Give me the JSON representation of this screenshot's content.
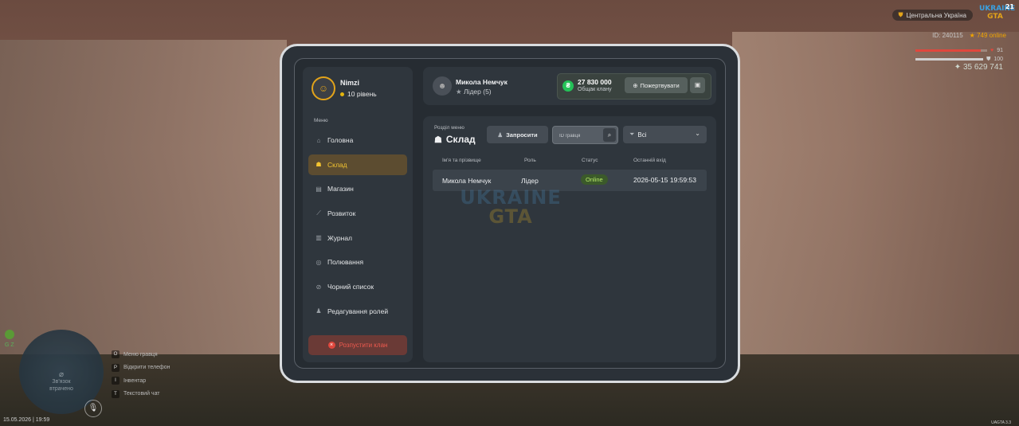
{
  "hud": {
    "server_name": "Центральна Україна",
    "logo_line1": "UKRAINE",
    "logo_line2": "GTA",
    "player_level": "21",
    "player_id": "ID: 240115",
    "online": "749 online",
    "health": "91",
    "armor": "100",
    "money": "35 629 741",
    "minimap_text_1": "Зв'язок",
    "minimap_text_2": "втрачено",
    "gps_label": "G Z",
    "mic_key": "B",
    "hints": [
      {
        "key": "O",
        "label": "Меню гравця"
      },
      {
        "key": "P",
        "label": "Відкрити телефон"
      },
      {
        "key": "I",
        "label": "Інвентар"
      },
      {
        "key": "T",
        "label": "Текстовий чат"
      }
    ],
    "datetime": "15.05.2026 | 19:59",
    "build": "UAGTA 3.3"
  },
  "sidebar": {
    "player_name": "Nimzi",
    "player_level": "10 рівень",
    "menu_title": "Меню",
    "items": [
      {
        "label": "Головна",
        "icon": "home-icon"
      },
      {
        "label": "Склад",
        "icon": "users-icon"
      },
      {
        "label": "Магазин",
        "icon": "basket-icon"
      },
      {
        "label": "Розвиток",
        "icon": "chart-icon"
      },
      {
        "label": "Журнал",
        "icon": "book-icon"
      },
      {
        "label": "Полювання",
        "icon": "target-icon"
      },
      {
        "label": "Чорний список",
        "icon": "block-icon"
      },
      {
        "label": "Редагування ролей",
        "icon": "user-edit-icon"
      }
    ],
    "active_index": 1,
    "disband_label": "Розпустити клан"
  },
  "header": {
    "user_name": "Микола Немчук",
    "user_role": "Лідер (5)",
    "fund_value": "27 830 000",
    "fund_label": "Общак клану",
    "donate_label": "Пожертвувати"
  },
  "main": {
    "section_sub": "Розділ меню",
    "section_title": "Склад",
    "invite_label": "Запросити",
    "search_placeholder": "ID гравця",
    "filter_value": "Всі",
    "columns": [
      "Ім'я та прізвище",
      "Роль",
      "Статус",
      "Останній вхід"
    ],
    "rows": [
      {
        "name": "Микола Немчук",
        "role": "Лідер",
        "status": "Online",
        "last_login": "2026-05-15 19:59:53"
      }
    ],
    "watermark_line1": "UKRAINE",
    "watermark_line2": "GTA"
  },
  "colors": {
    "accent": "#f4c430",
    "active_bg": "#5c4c30",
    "danger": "#e0473d",
    "online": "#b6e868",
    "coin": "#24c258"
  }
}
